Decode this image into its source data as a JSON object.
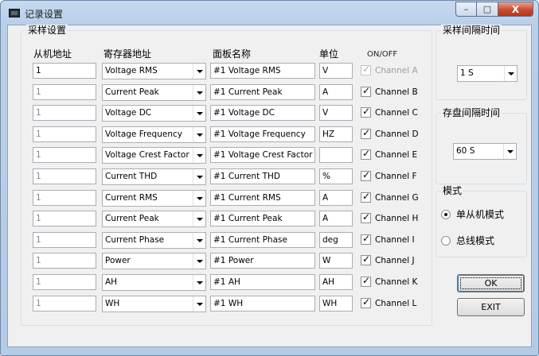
{
  "window": {
    "title": "记录设置",
    "close": "X",
    "minimize": "–",
    "maximize": "□"
  },
  "sample_group": {
    "title": "采样设置",
    "headers": {
      "slave": "从机地址",
      "register": "寄存器地址",
      "panel_name": "面板名称",
      "unit": "单位",
      "onoff": "ON/OFF"
    },
    "rows": [
      {
        "slave": "1",
        "register": "Voltage RMS",
        "panel": "#1 Voltage RMS",
        "unit": "V",
        "channel": "Channel A",
        "checked": true,
        "enabled": false
      },
      {
        "slave": "1",
        "register": "Current Peak",
        "panel": "#1 Current Peak",
        "unit": "A",
        "channel": "Channel B",
        "checked": true,
        "enabled": true
      },
      {
        "slave": "1",
        "register": "Voltage DC",
        "panel": "#1 Voltage DC",
        "unit": "V",
        "channel": "Channel C",
        "checked": true,
        "enabled": true
      },
      {
        "slave": "1",
        "register": "Voltage Frequency",
        "panel": "#1 Voltage Frequency",
        "unit": "HZ",
        "channel": "Channel D",
        "checked": true,
        "enabled": true
      },
      {
        "slave": "1",
        "register": "Voltage Crest Factor",
        "panel": "#1 Voltage Crest Factor",
        "unit": "",
        "channel": "Channel E",
        "checked": true,
        "enabled": true
      },
      {
        "slave": "1",
        "register": "Current THD",
        "panel": "#1 Current THD",
        "unit": "%",
        "channel": "Channel F",
        "checked": true,
        "enabled": true
      },
      {
        "slave": "1",
        "register": "Current RMS",
        "panel": "#1 Current RMS",
        "unit": "A",
        "channel": "Channel G",
        "checked": true,
        "enabled": true
      },
      {
        "slave": "1",
        "register": "Current Peak",
        "panel": "#1 Current Peak",
        "unit": "A",
        "channel": "Channel H",
        "checked": true,
        "enabled": true
      },
      {
        "slave": "1",
        "register": "Current Phase",
        "panel": "#1 Current Phase",
        "unit": "deg",
        "channel": "Channel I",
        "checked": true,
        "enabled": true
      },
      {
        "slave": "1",
        "register": "Power",
        "panel": "#1 Power",
        "unit": "W",
        "channel": "Channel J",
        "checked": true,
        "enabled": true
      },
      {
        "slave": "1",
        "register": "AH",
        "panel": "#1 AH",
        "unit": "AH",
        "channel": "Channel K",
        "checked": true,
        "enabled": true
      },
      {
        "slave": "1",
        "register": "WH",
        "panel": "#1 WH",
        "unit": "WH",
        "channel": "Channel L",
        "checked": true,
        "enabled": true
      }
    ]
  },
  "sample_interval": {
    "title": "采样间隔时间",
    "value": "1 S"
  },
  "save_interval": {
    "title": "存盘间隔时间",
    "value": "60 S"
  },
  "mode": {
    "title": "模式",
    "single": "单从机模式",
    "bus": "总线模式",
    "selected": "single"
  },
  "buttons": {
    "ok": "OK",
    "exit": "EXIT"
  }
}
